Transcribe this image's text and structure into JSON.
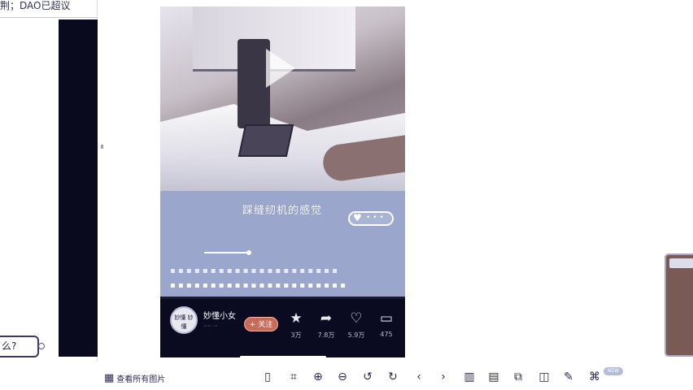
{
  "background_page": {
    "title_fragment": "荆；DAO已超议",
    "bubble_text": "么?"
  },
  "viewer": {
    "caption": "踩缝纫机的感觉",
    "like_pill_text": "• • •",
    "video_progress": 0.18,
    "subtitle_line1": "▪ ▪ ▪ ▪ ▪ ▪ ▪ ▪ ▪ ▪ ▪ ▪ ▪ ▪ ▪ ▪ ▪ ▪ ▪ ▪ ▪",
    "subtitle_line2": "▪ ▪ ▪ ▪ ▪ ▪ ▪ ▪ ▪ ▪ ▪ ▪ ▪ ▪ ▪ ▪ ▪ ▪ ▪ ▪ ▪ ▪",
    "author": {
      "avatar_text": "妙懂 妙懂",
      "name": "妙懂小女",
      "sub": "···· ··",
      "follow_label": "+ 关注"
    },
    "actions": [
      {
        "icon": "star-icon",
        "glyph": "★",
        "count": "3万"
      },
      {
        "icon": "share-icon",
        "glyph": "➦",
        "count": "7.8万"
      },
      {
        "icon": "heart-icon",
        "glyph": "♡",
        "count": "5.9万"
      },
      {
        "icon": "comment-icon",
        "glyph": "▭",
        "count": "475"
      }
    ]
  },
  "toolbar": {
    "view_all_label": "查看所有图片",
    "badge": "NEW",
    "icons": [
      "mouse-icon",
      "crop-icon",
      "zoom-in-icon",
      "zoom-out-icon",
      "rotate-left-icon",
      "rotate-right-icon",
      "prev-icon",
      "next-icon",
      "delete-icon",
      "print-icon",
      "copy-icon",
      "compare-icon",
      "edit-icon",
      "translate-icon"
    ]
  }
}
